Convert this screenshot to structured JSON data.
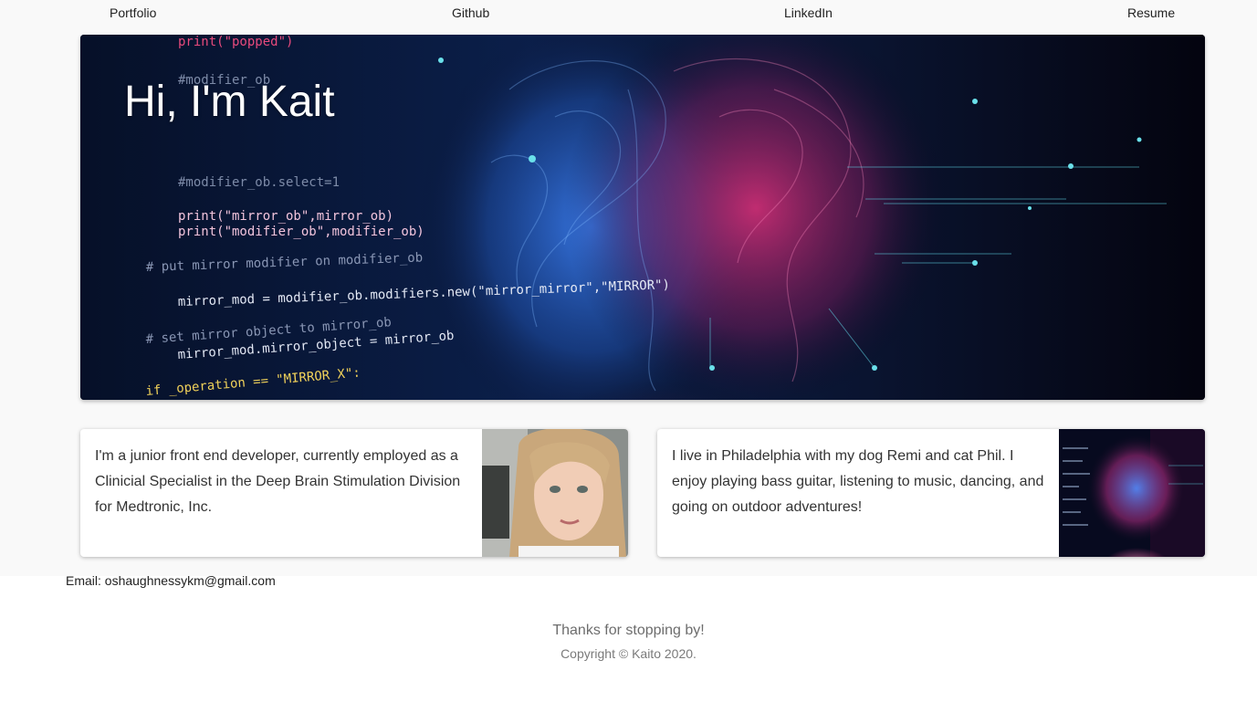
{
  "nav": {
    "items": [
      {
        "label": "Portfolio"
      },
      {
        "label": "Github"
      },
      {
        "label": "LinkedIn"
      },
      {
        "label": "Resume"
      }
    ]
  },
  "hero": {
    "title": "Hi, I'm Kait",
    "code_lines": [
      "print(\"popped\")",
      "#modifier_ob",
      "#modifier_ob.select=1",
      "print(\"mirror_ob\",mirror_ob)",
      "print(\"modifier_ob\",modifier_ob)",
      "# put mirror modifier on modifier_ob",
      "mirror_mod = modifier_ob.modifiers.new(\"mirror_mirror\",\"MIRROR\")",
      "# set mirror object to mirror_ob",
      "mirror_mod.mirror_object = mirror_ob",
      "if _operation == \"MIRROR_X\":"
    ]
  },
  "cards": [
    {
      "text": "I'm a junior front end developer, currently employed as a Clinicial Specialist in the Deep Brain Stimulation Division for Medtronic, Inc.",
      "image": "profile-photo"
    },
    {
      "text": "I live in Philadelphia with my dog Remi and cat Phil. I enjoy playing bass guitar, listening to music, dancing, and going on outdoor adventures!",
      "image": "brain-code-image"
    }
  ],
  "contact": {
    "email": "Email: oshaughnessykm@gmail.com"
  },
  "footer": {
    "thanks": "Thanks for stopping by!",
    "copyright": "Copyright © Kaito 2020."
  },
  "colors": {
    "hero_background": "#050818",
    "brain_pink": "#c0246a",
    "brain_blue": "#2b6fd6",
    "page_background": "#f9f9f9"
  }
}
